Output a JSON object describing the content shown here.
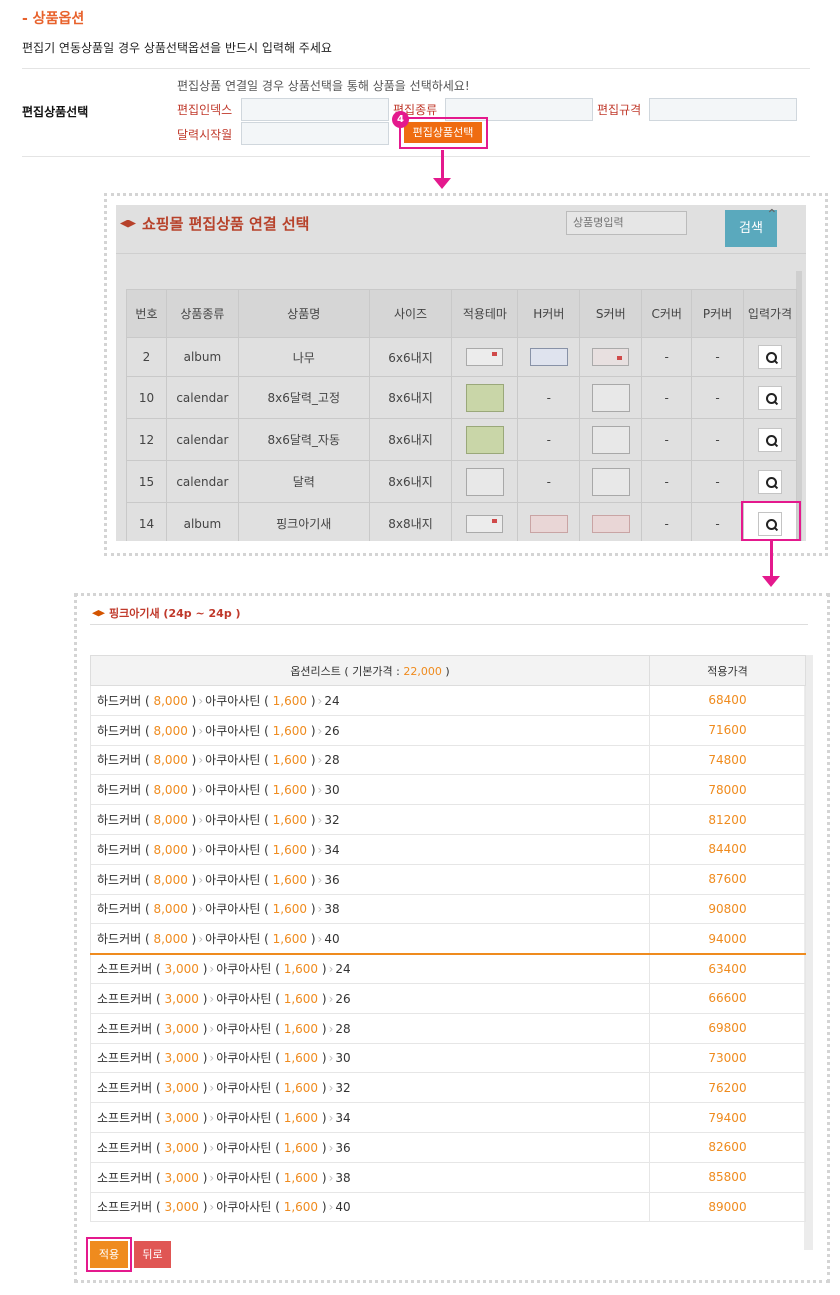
{
  "section": {
    "title": "- 상품옵션",
    "note": "편집기 연동상품일 경우 상품선택옵션을 반드시 입력해 주세요"
  },
  "form": {
    "row_label": "편집상품선택",
    "hint": "편집상품 연결일 경우 상품선택을 통해 상품을 선택하세요!",
    "index_label": "편집인덱스",
    "kind_label": "편집종류",
    "spec_label": "편집규격",
    "start_label": "달력시작월",
    "select_button": "편집상품선택",
    "step_badge": "4"
  },
  "modal1": {
    "title": "쇼핑몰 편집상품 연결 선택",
    "search_placeholder": "상품명입력",
    "search_button": "검색",
    "columns": [
      "번호",
      "상품종류",
      "상품명",
      "사이즈",
      "적용테마",
      "H커버",
      "S커버",
      "C커버",
      "P커버",
      "입력가격"
    ],
    "rows": [
      {
        "no": "2",
        "kind": "album",
        "name": "나무",
        "size": "6x6내지",
        "h": "",
        "s": "",
        "c": "-",
        "p": "-"
      },
      {
        "no": "10",
        "kind": "calendar",
        "name": "8x6달력_고정",
        "size": "8x6내지",
        "h": "-",
        "s": "",
        "c": "-",
        "p": "-"
      },
      {
        "no": "12",
        "kind": "calendar",
        "name": "8x6달력_자동",
        "size": "8x6내지",
        "h": "-",
        "s": "",
        "c": "-",
        "p": "-"
      },
      {
        "no": "15",
        "kind": "calendar",
        "name": "달력",
        "size": "8x6내지",
        "h": "-",
        "s": "",
        "c": "-",
        "p": "-"
      },
      {
        "no": "14",
        "kind": "album",
        "name": "핑크아기새",
        "size": "8x8내지",
        "h": "",
        "s": "",
        "c": "-",
        "p": "-"
      }
    ]
  },
  "options": {
    "title": "핑크아기새 (24p ~ 24p )",
    "header_list": "옵션리스트 ( 기본가격 :",
    "base_price": "22,000",
    "header_close": ")",
    "header_price": "적용가격",
    "hard_cover": "하드커버",
    "hard_price": "8,000",
    "soft_cover": "소프트커버",
    "soft_price": "3,000",
    "paper": "아쿠아사틴",
    "paper_price": "1,600",
    "hard_rows": [
      {
        "pages": "24",
        "price": "68400"
      },
      {
        "pages": "26",
        "price": "71600"
      },
      {
        "pages": "28",
        "price": "74800"
      },
      {
        "pages": "30",
        "price": "78000"
      },
      {
        "pages": "32",
        "price": "81200"
      },
      {
        "pages": "34",
        "price": "84400"
      },
      {
        "pages": "36",
        "price": "87600"
      },
      {
        "pages": "38",
        "price": "90800"
      },
      {
        "pages": "40",
        "price": "94000"
      }
    ],
    "soft_rows": [
      {
        "pages": "24",
        "price": "63400"
      },
      {
        "pages": "26",
        "price": "66600"
      },
      {
        "pages": "28",
        "price": "69800"
      },
      {
        "pages": "30",
        "price": "73000"
      },
      {
        "pages": "32",
        "price": "76200"
      },
      {
        "pages": "34",
        "price": "79400"
      },
      {
        "pages": "36",
        "price": "82600"
      },
      {
        "pages": "38",
        "price": "85800"
      },
      {
        "pages": "40",
        "price": "89000"
      }
    ],
    "apply_button": "적용",
    "back_button": "뒤로"
  }
}
